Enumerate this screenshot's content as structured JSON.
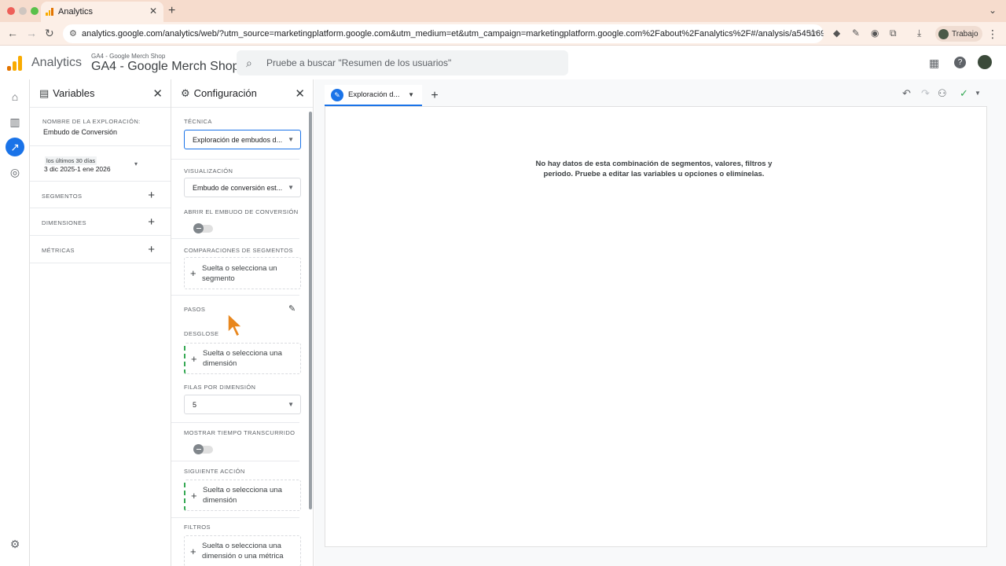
{
  "browser": {
    "tab_title": "Analytics",
    "url": "analytics.google.com/analytics/web/?utm_source=marketingplatform.google.com&utm_medium=et&utm_campaign=marketingplatform.google.com%2Fabout%2Fanalytics%2F#/analysis/a54516992p21302...",
    "profile_label": "Trabajo"
  },
  "header": {
    "app_name": "Analytics",
    "property_small": "GA4 - Google Merch Shop",
    "property_big": "GA4 - Google Merch Shop",
    "search_placeholder": "Pruebe a buscar \"Resumen de los usuarios\""
  },
  "variables": {
    "title": "Variables",
    "name_label": "NOMBRE DE LA EXPLORACIÓN:",
    "name_value": "Embudo de Conversión",
    "date_label": "los últimos 30 días",
    "date_range": "3 dic 2025-1 ene 2026",
    "segments": "SEGMENTOS",
    "dimensions": "DIMENSIONES",
    "metrics": "MÉTRICAS"
  },
  "config": {
    "title": "Configuración",
    "technique_label": "TÉCNICA",
    "technique_value": "Exploración de embudos d...",
    "visualization_label": "VISUALIZACIÓN",
    "visualization_value": "Embudo de conversión est...",
    "open_funnel_label": "ABRIR EL EMBUDO DE CONVERSIÓN",
    "open_funnel_on": false,
    "segment_comparisons_label": "COMPARACIONES DE SEGMENTOS",
    "segment_drop": "Suelta o selecciona un segmento",
    "steps_label": "PASOS",
    "breakdown_label": "DESGLOSE",
    "breakdown_drop": "Suelta o selecciona una dimensión",
    "rows_label": "FILAS POR DIMENSIÓN",
    "rows_value": "5",
    "elapsed_label": "MOSTRAR TIEMPO TRANSCURRIDO",
    "elapsed_on": false,
    "next_action_label": "SIGUIENTE ACCIÓN",
    "next_action_drop": "Suelta o selecciona una dimensión",
    "filters_label": "FILTROS",
    "filters_drop": "Suelta o selecciona una dimensión o una métrica"
  },
  "canvas": {
    "tab_label": "Exploración d...",
    "empty_message": "No hay datos de esta combinación de segmentos, valores, filtros y periodo. Pruebe a editar las variables u opciones o elimínelas."
  },
  "colors": {
    "accent": "#1a73e8",
    "logo_orange": "#f9ab00",
    "logo_dark": "#e37400",
    "green_dash": "#34a853"
  }
}
